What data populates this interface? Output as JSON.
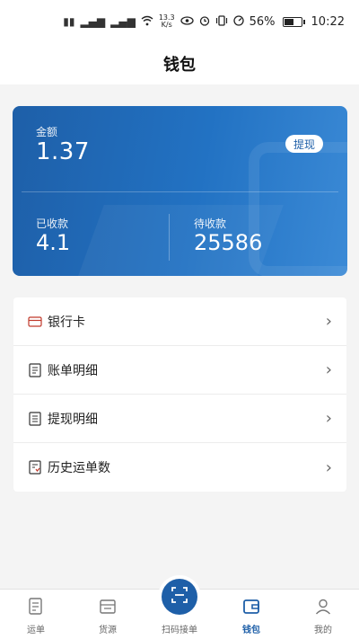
{
  "status_bar": {
    "net_speed_top": "13.3",
    "net_speed_bottom": "K/s",
    "battery_percent": "56%",
    "battery_level": 0.56,
    "time": "10:22"
  },
  "header": {
    "title": "钱包"
  },
  "wallet": {
    "amount_label": "金额",
    "amount_value": "1.37",
    "withdraw_label": "提现",
    "received_label": "已收款",
    "received_value": "4.1",
    "pending_label": "待收款",
    "pending_value": "25586"
  },
  "menu": {
    "items": [
      {
        "label": "银行卡",
        "icon": "bank-card-icon"
      },
      {
        "label": "账单明细",
        "icon": "bill-icon"
      },
      {
        "label": "提现明细",
        "icon": "withdraw-record-icon"
      },
      {
        "label": "历史运单数",
        "icon": "history-icon"
      }
    ]
  },
  "bottom_nav": {
    "items": [
      {
        "label": "运单"
      },
      {
        "label": "货源"
      },
      {
        "label": "扫码接单"
      },
      {
        "label": "钱包"
      },
      {
        "label": "我的"
      }
    ],
    "active_index": 3
  },
  "colors": {
    "accent": "#1e5fa8",
    "card_gradient_start": "#1e5fa8",
    "card_gradient_end": "#3b8ad6"
  }
}
